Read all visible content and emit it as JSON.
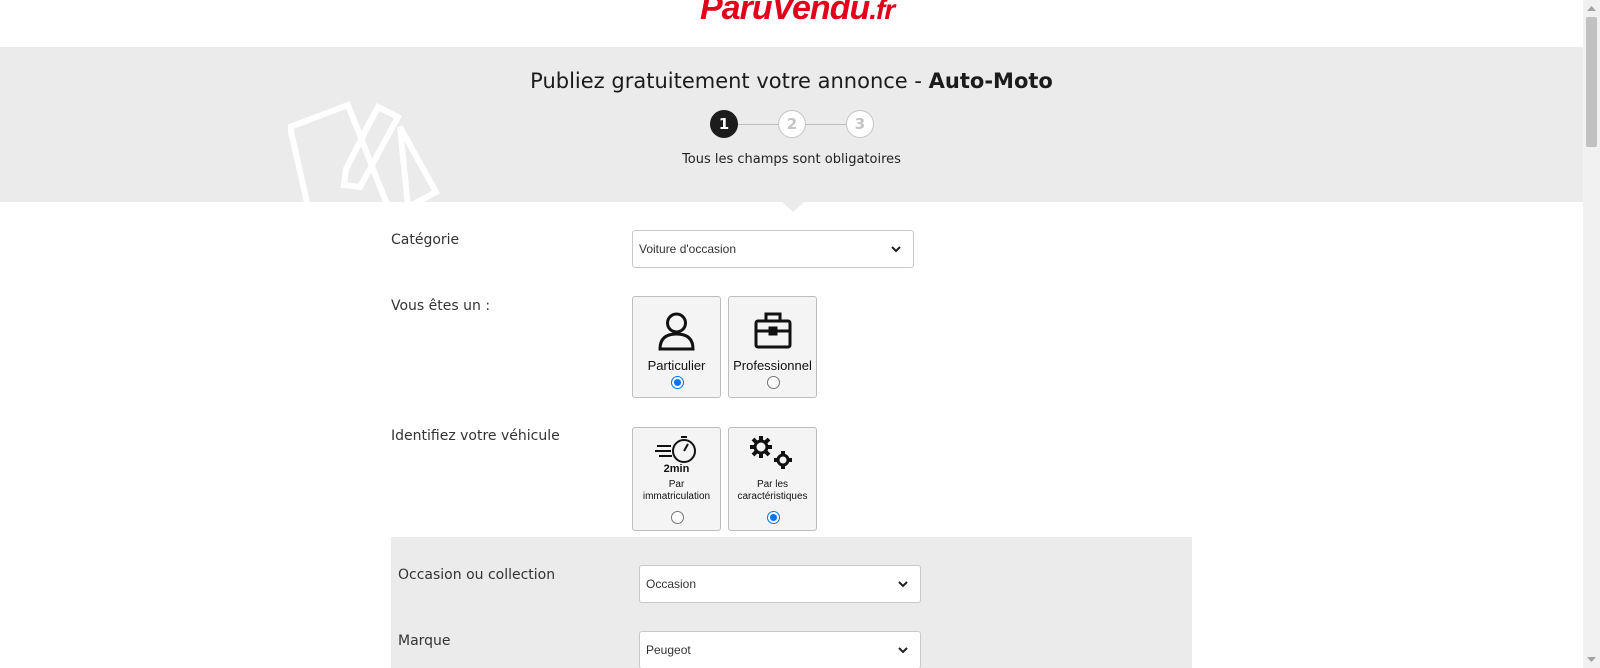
{
  "logo": {
    "part1": "Paru",
    "part2": "Vendu",
    "part3": ".fr"
  },
  "hero": {
    "title_prefix": "Publiez gratuitement votre annonce - ",
    "title_bold": "Auto-Moto",
    "subtitle": "Tous les champs sont obligatoires",
    "steps": [
      "1",
      "2",
      "3"
    ],
    "active_step": 1
  },
  "form": {
    "categorie": {
      "label": "Catégorie",
      "value": "Voiture d'occasion"
    },
    "vous_etes": {
      "label": "Vous êtes un :",
      "options": [
        {
          "label": "Particulier",
          "icon": "person-icon",
          "selected": true
        },
        {
          "label": "Professionnel",
          "icon": "briefcase-icon",
          "selected": false
        }
      ]
    },
    "identifiez": {
      "label": "Identifiez votre véhicule",
      "options": [
        {
          "label_line1": "Par",
          "label_line2": "immatriculation",
          "icon": "stopwatch-icon",
          "icon_text": "2min",
          "selected": false
        },
        {
          "label_line1": "Par les",
          "label_line2": "caractéristiques",
          "icon": "gears-icon",
          "selected": true
        }
      ]
    },
    "occasion": {
      "label": "Occasion ou collection",
      "value": "Occasion"
    },
    "marque": {
      "label": "Marque",
      "value": "Peugeot"
    }
  },
  "colors": {
    "brand": "#e3001b",
    "accent": "#0075ff",
    "panel": "#ebebeb"
  }
}
